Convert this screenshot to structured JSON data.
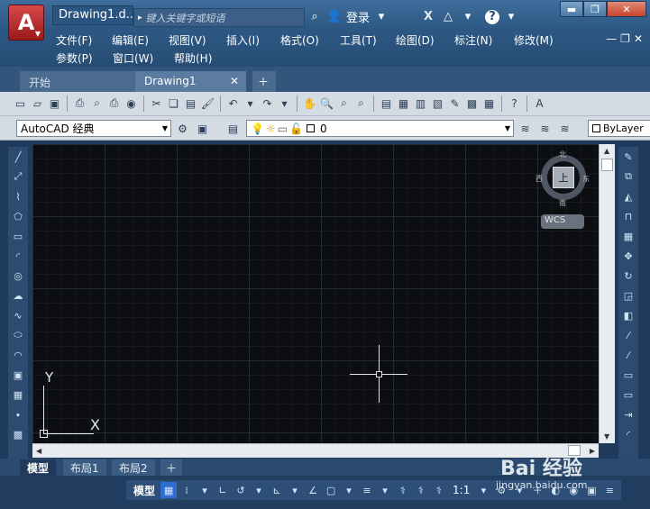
{
  "titlebar": {
    "doc_title": "Drawing1.d...",
    "search_placeholder": "键入关键字或短语",
    "login_label": "登录"
  },
  "menus": {
    "row1": [
      "文件(F)",
      "编辑(E)",
      "视图(V)",
      "插入(I)",
      "格式(O)",
      "工具(T)",
      "绘图(D)",
      "标注(N)",
      "修改(M)"
    ],
    "row2": [
      "参数(P)",
      "窗口(W)",
      "帮助(H)"
    ]
  },
  "file_tabs": {
    "start": "开始",
    "drawing": "Drawing1"
  },
  "toolbar2": {
    "workspace": "AutoCAD 经典",
    "layer": "0",
    "bylayer": "ByLayer"
  },
  "viewcube": {
    "north": "北",
    "south": "南",
    "east": "东",
    "west": "西",
    "face": "上",
    "wcs": "WCS"
  },
  "ucs": {
    "x_label": "X",
    "y_label": "Y"
  },
  "layout_tabs": [
    "模型",
    "布局1",
    "布局2"
  ],
  "status": {
    "model_label": "模型",
    "scale": "1:1"
  },
  "watermark": {
    "brand": "Bai 经验",
    "url": "jingyan.baidu.com"
  },
  "colors": {
    "canvas_bg": "#0c0e12",
    "chrome": "#2b5782",
    "app_red": "#c62a2c"
  }
}
